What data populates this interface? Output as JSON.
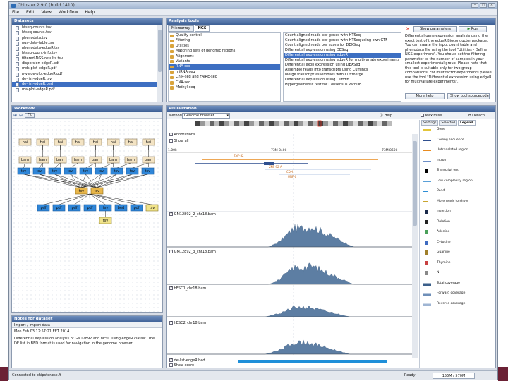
{
  "window": {
    "title": "Chipster 2.9.0 (build 1410)"
  },
  "menu": [
    "File",
    "Edit",
    "View",
    "Workflow",
    "Help"
  ],
  "datasets": {
    "title": "Datasets",
    "items": [
      {
        "label": "htseq-counts.tsv",
        "selected": false
      },
      {
        "label": "htseq-counts.tsv",
        "selected": false
      },
      {
        "label": "phenodata.tsv",
        "selected": false
      },
      {
        "label": "ngs-data-table.tsv",
        "selected": false
      },
      {
        "label": "phenodata-edgeR.tsv",
        "selected": false
      },
      {
        "label": "htseq-count-info.tsv",
        "selected": false
      },
      {
        "label": "filtered-NGS-results.tsv",
        "selected": false
      },
      {
        "label": "dispersion-edgeR.pdf",
        "selected": false
      },
      {
        "label": "mds-plot-edgeR.pdf",
        "selected": false
      },
      {
        "label": "p-value-plot-edgeR.pdf",
        "selected": false
      },
      {
        "label": "de-list-edgeR.tsv",
        "selected": false
      },
      {
        "label": "de-list-edgeR.bed",
        "selected": true
      },
      {
        "label": "ma-plot-edgeR.pdf",
        "selected": false
      }
    ]
  },
  "analysis": {
    "title": "Analysis tools",
    "tabs": [
      "Microarray",
      "NGS"
    ],
    "active_tab": "NGS",
    "categories": [
      {
        "label": "Quality control",
        "selected": false
      },
      {
        "label": "Filtering",
        "selected": false
      },
      {
        "label": "Utilities",
        "selected": false
      },
      {
        "label": "Matching sets of genomic regions",
        "selected": false
      },
      {
        "label": "Alignment",
        "selected": false
      },
      {
        "label": "Variants",
        "selected": false
      },
      {
        "label": "RNA-seq",
        "selected": true
      },
      {
        "label": "miRNA-seq",
        "selected": false
      },
      {
        "label": "ChIP-seq and FAIRE-seq",
        "selected": false
      },
      {
        "label": "CNA-seq",
        "selected": false
      },
      {
        "label": "Methyl-seq",
        "selected": false
      }
    ],
    "tools": [
      {
        "label": "Count aligned reads per genes with HTSeq",
        "selected": false
      },
      {
        "label": "Count aligned reads per genes with HTSeq using own GTF",
        "selected": false
      },
      {
        "label": "Count aligned reads per exons for DEXSeq",
        "selected": false
      },
      {
        "label": "Differential expression using DESeq",
        "selected": false
      },
      {
        "label": "Differential expression using edgeR",
        "selected": true
      },
      {
        "label": "Differential expression using edgeR for multivariate experiments",
        "selected": false
      },
      {
        "label": "Differential exon expression using DEXSeq",
        "selected": false
      },
      {
        "label": "Assemble reads into transcripts using Cufflinks",
        "selected": false
      },
      {
        "label": "Merge transcript assemblies with Cuffmerge",
        "selected": false
      },
      {
        "label": "Differential expression using Cuffdiff",
        "selected": false
      },
      {
        "label": "Hypergeometric test for Consensus PathDB",
        "selected": false
      }
    ],
    "close_glyph": "✕",
    "show_params": "Show parameters",
    "run": "Run",
    "description": "Differential gene expression analysis using the exact test of the edgeR Bioconductor package. You can create the input count table and phenodata file using the tool \"Utilities - Define NGS experiment\". You should set the filtering parameter to the number of samples in your smallest experimental group. Please note that this tool is suitable only for two group comparisons. For multifactor experiments please use the tool \"Differential expression using edgeR for multivariate experiments\".",
    "more_help": "More help",
    "show_source": "Show tool sourcecode"
  },
  "workflow": {
    "title": "Workflow",
    "zoom_in": "⊕",
    "zoom_out": "⊖",
    "fit": "Fit",
    "row1": [
      "bai",
      "bai",
      "bai",
      "bai",
      "bai",
      "bai",
      "bai",
      "bai"
    ],
    "row2": [
      "bam",
      "bam",
      "bam",
      "bam",
      "bam",
      "bam",
      "bam",
      "bam"
    ],
    "row3": [
      "tsv",
      "tsv",
      "tsv",
      "tsv",
      "tsv",
      "tsv",
      "tsv",
      "tsv",
      "tsv",
      "txt"
    ],
    "mid": [
      "tsv",
      "tsv"
    ],
    "row4": [
      "pdf",
      "pdf",
      "pdf",
      "pdf",
      "tsv",
      "bed",
      "pdf",
      "tsv"
    ],
    "leaf": "tsv"
  },
  "notes": {
    "title": "Notes for dataset",
    "tabs": "Import / Import data",
    "date": "Mon Feb 03 12:57:21 EET 2014",
    "text": "Differential expression analysis of GM12892 and hESC using edgeR classic. The DE list in BED format is used for navigation in the genome browser."
  },
  "visualization": {
    "title": "Visualization",
    "method_label": "Method",
    "method_value": "Genome browser",
    "help": "Help",
    "maximise": "Maximise",
    "detach": "Detach",
    "tracks_label": "Annotations",
    "show_all": "Show all",
    "ruler": [
      "1.00k",
      "73M 840k",
      "73M 860k"
    ],
    "genes": [
      "ZNF-S2",
      "ZNF-S2-A",
      "CDH",
      "UNF-0"
    ],
    "samples": [
      "GM12892_2_chr18.bam",
      "GM12892_3_chr18.bam",
      "hESC1_chr18.bam",
      "hESC2_chr18.bam"
    ],
    "bed_track": "de-list-edgeR.bed",
    "show_score": "Show score",
    "legend_tabs": [
      "Settings",
      "Selected",
      "Legend"
    ],
    "legend_active": "Legend",
    "legend": [
      {
        "label": "Gene",
        "color": "#e3c53a"
      },
      {
        "label": "Coding sequence",
        "color": "#2f4f8f"
      },
      {
        "label": "Untranslated region",
        "color": "#e88b1f"
      },
      {
        "label": "Intron",
        "color": "#6d8fc7"
      },
      {
        "label": "Transcript end",
        "color": "#000000"
      },
      {
        "label": "Low complexity region",
        "color": "#5aa0d8"
      },
      {
        "label": "Read",
        "color": "#2d8ed6"
      },
      {
        "label": "More reads to show",
        "color": "#c9a52f"
      },
      {
        "label": "Insertion",
        "color": "#1a2a4a"
      },
      {
        "label": "Deletion",
        "color": "#222222"
      },
      {
        "label": "Adenine",
        "color": "#4aa05a"
      },
      {
        "label": "Cytosine",
        "color": "#3e6bc0"
      },
      {
        "label": "Guanine",
        "color": "#a07f2a"
      },
      {
        "label": "Thymine",
        "color": "#c84040"
      },
      {
        "label": "N",
        "color": "#888888"
      },
      {
        "label": "Total coverage",
        "color": "#3b5f8a"
      },
      {
        "label": "Forward coverage",
        "color": "#6f8fb8"
      },
      {
        "label": "Reverse coverage",
        "color": "#9fb5d3"
      }
    ]
  },
  "status": {
    "left": "Connected to chipster.csc.fi",
    "ready": "Ready",
    "memory": "155M / 570M"
  }
}
